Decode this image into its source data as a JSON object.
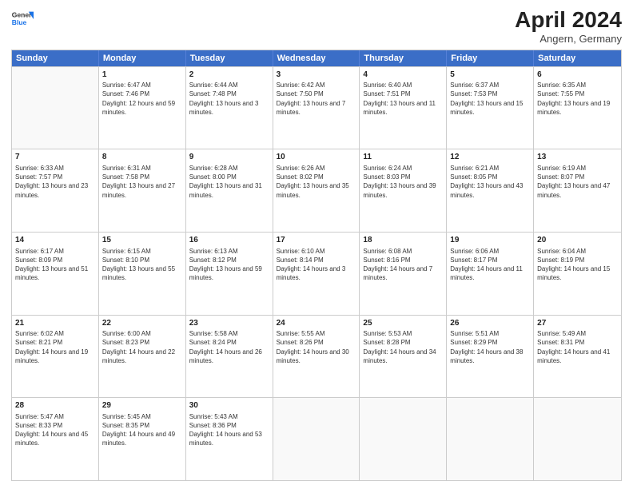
{
  "header": {
    "logo_text_general": "General",
    "logo_text_blue": "Blue",
    "month_title": "April 2024",
    "subtitle": "Angern, Germany"
  },
  "days_of_week": [
    "Sunday",
    "Monday",
    "Tuesday",
    "Wednesday",
    "Thursday",
    "Friday",
    "Saturday"
  ],
  "weeks": [
    [
      {
        "day": "",
        "sunrise": "",
        "sunset": "",
        "daylight": ""
      },
      {
        "day": "1",
        "sunrise": "Sunrise: 6:47 AM",
        "sunset": "Sunset: 7:46 PM",
        "daylight": "Daylight: 12 hours and 59 minutes."
      },
      {
        "day": "2",
        "sunrise": "Sunrise: 6:44 AM",
        "sunset": "Sunset: 7:48 PM",
        "daylight": "Daylight: 13 hours and 3 minutes."
      },
      {
        "day": "3",
        "sunrise": "Sunrise: 6:42 AM",
        "sunset": "Sunset: 7:50 PM",
        "daylight": "Daylight: 13 hours and 7 minutes."
      },
      {
        "day": "4",
        "sunrise": "Sunrise: 6:40 AM",
        "sunset": "Sunset: 7:51 PM",
        "daylight": "Daylight: 13 hours and 11 minutes."
      },
      {
        "day": "5",
        "sunrise": "Sunrise: 6:37 AM",
        "sunset": "Sunset: 7:53 PM",
        "daylight": "Daylight: 13 hours and 15 minutes."
      },
      {
        "day": "6",
        "sunrise": "Sunrise: 6:35 AM",
        "sunset": "Sunset: 7:55 PM",
        "daylight": "Daylight: 13 hours and 19 minutes."
      }
    ],
    [
      {
        "day": "7",
        "sunrise": "Sunrise: 6:33 AM",
        "sunset": "Sunset: 7:57 PM",
        "daylight": "Daylight: 13 hours and 23 minutes."
      },
      {
        "day": "8",
        "sunrise": "Sunrise: 6:31 AM",
        "sunset": "Sunset: 7:58 PM",
        "daylight": "Daylight: 13 hours and 27 minutes."
      },
      {
        "day": "9",
        "sunrise": "Sunrise: 6:28 AM",
        "sunset": "Sunset: 8:00 PM",
        "daylight": "Daylight: 13 hours and 31 minutes."
      },
      {
        "day": "10",
        "sunrise": "Sunrise: 6:26 AM",
        "sunset": "Sunset: 8:02 PM",
        "daylight": "Daylight: 13 hours and 35 minutes."
      },
      {
        "day": "11",
        "sunrise": "Sunrise: 6:24 AM",
        "sunset": "Sunset: 8:03 PM",
        "daylight": "Daylight: 13 hours and 39 minutes."
      },
      {
        "day": "12",
        "sunrise": "Sunrise: 6:21 AM",
        "sunset": "Sunset: 8:05 PM",
        "daylight": "Daylight: 13 hours and 43 minutes."
      },
      {
        "day": "13",
        "sunrise": "Sunrise: 6:19 AM",
        "sunset": "Sunset: 8:07 PM",
        "daylight": "Daylight: 13 hours and 47 minutes."
      }
    ],
    [
      {
        "day": "14",
        "sunrise": "Sunrise: 6:17 AM",
        "sunset": "Sunset: 8:09 PM",
        "daylight": "Daylight: 13 hours and 51 minutes."
      },
      {
        "day": "15",
        "sunrise": "Sunrise: 6:15 AM",
        "sunset": "Sunset: 8:10 PM",
        "daylight": "Daylight: 13 hours and 55 minutes."
      },
      {
        "day": "16",
        "sunrise": "Sunrise: 6:13 AM",
        "sunset": "Sunset: 8:12 PM",
        "daylight": "Daylight: 13 hours and 59 minutes."
      },
      {
        "day": "17",
        "sunrise": "Sunrise: 6:10 AM",
        "sunset": "Sunset: 8:14 PM",
        "daylight": "Daylight: 14 hours and 3 minutes."
      },
      {
        "day": "18",
        "sunrise": "Sunrise: 6:08 AM",
        "sunset": "Sunset: 8:16 PM",
        "daylight": "Daylight: 14 hours and 7 minutes."
      },
      {
        "day": "19",
        "sunrise": "Sunrise: 6:06 AM",
        "sunset": "Sunset: 8:17 PM",
        "daylight": "Daylight: 14 hours and 11 minutes."
      },
      {
        "day": "20",
        "sunrise": "Sunrise: 6:04 AM",
        "sunset": "Sunset: 8:19 PM",
        "daylight": "Daylight: 14 hours and 15 minutes."
      }
    ],
    [
      {
        "day": "21",
        "sunrise": "Sunrise: 6:02 AM",
        "sunset": "Sunset: 8:21 PM",
        "daylight": "Daylight: 14 hours and 19 minutes."
      },
      {
        "day": "22",
        "sunrise": "Sunrise: 6:00 AM",
        "sunset": "Sunset: 8:23 PM",
        "daylight": "Daylight: 14 hours and 22 minutes."
      },
      {
        "day": "23",
        "sunrise": "Sunrise: 5:58 AM",
        "sunset": "Sunset: 8:24 PM",
        "daylight": "Daylight: 14 hours and 26 minutes."
      },
      {
        "day": "24",
        "sunrise": "Sunrise: 5:55 AM",
        "sunset": "Sunset: 8:26 PM",
        "daylight": "Daylight: 14 hours and 30 minutes."
      },
      {
        "day": "25",
        "sunrise": "Sunrise: 5:53 AM",
        "sunset": "Sunset: 8:28 PM",
        "daylight": "Daylight: 14 hours and 34 minutes."
      },
      {
        "day": "26",
        "sunrise": "Sunrise: 5:51 AM",
        "sunset": "Sunset: 8:29 PM",
        "daylight": "Daylight: 14 hours and 38 minutes."
      },
      {
        "day": "27",
        "sunrise": "Sunrise: 5:49 AM",
        "sunset": "Sunset: 8:31 PM",
        "daylight": "Daylight: 14 hours and 41 minutes."
      }
    ],
    [
      {
        "day": "28",
        "sunrise": "Sunrise: 5:47 AM",
        "sunset": "Sunset: 8:33 PM",
        "daylight": "Daylight: 14 hours and 45 minutes."
      },
      {
        "day": "29",
        "sunrise": "Sunrise: 5:45 AM",
        "sunset": "Sunset: 8:35 PM",
        "daylight": "Daylight: 14 hours and 49 minutes."
      },
      {
        "day": "30",
        "sunrise": "Sunrise: 5:43 AM",
        "sunset": "Sunset: 8:36 PM",
        "daylight": "Daylight: 14 hours and 53 minutes."
      },
      {
        "day": "",
        "sunrise": "",
        "sunset": "",
        "daylight": ""
      },
      {
        "day": "",
        "sunrise": "",
        "sunset": "",
        "daylight": ""
      },
      {
        "day": "",
        "sunrise": "",
        "sunset": "",
        "daylight": ""
      },
      {
        "day": "",
        "sunrise": "",
        "sunset": "",
        "daylight": ""
      }
    ]
  ]
}
